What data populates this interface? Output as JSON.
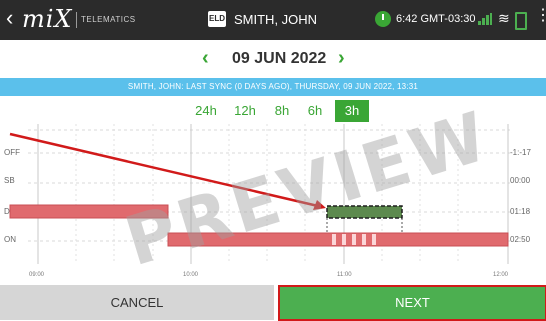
{
  "topbar": {
    "back_glyph": "‹",
    "logo": "miX",
    "telematics": "TELEMATICS",
    "eld_badge": "ELD",
    "driver": "SMITH, JOHN",
    "time": "6:42 GMT-03:30",
    "menu_glyph": "⋮",
    "wifi_glyph": "≋"
  },
  "date_nav": {
    "prev_glyph": "‹",
    "date": "09 JUN 2022",
    "next_glyph": "›"
  },
  "sync_text": "SMITH, JOHN: LAST SYNC (0 DAYS AGO), THURSDAY, 09 JUN 2022, 13:31",
  "zoom_options": [
    "24h",
    "12h",
    "8h",
    "6h",
    "3h"
  ],
  "zoom_selected": "3h",
  "graph": {
    "status_labels": [
      "OFF",
      "SB",
      "D",
      "ON"
    ],
    "totals": [
      "-1:-17",
      "00:00",
      "01:18",
      "02:50"
    ],
    "time_labels": [
      "09:00",
      "10:00",
      "11:00",
      "12:00"
    ]
  },
  "watermark": "PREVIEW",
  "buttons": {
    "cancel": "CANCEL",
    "next": "NEXT"
  },
  "colors": {
    "accent_green": "#3aa635",
    "sync_blue": "#5bc0eb",
    "duty_red": "#e06a6e",
    "arrow_red": "#d11a1a"
  }
}
